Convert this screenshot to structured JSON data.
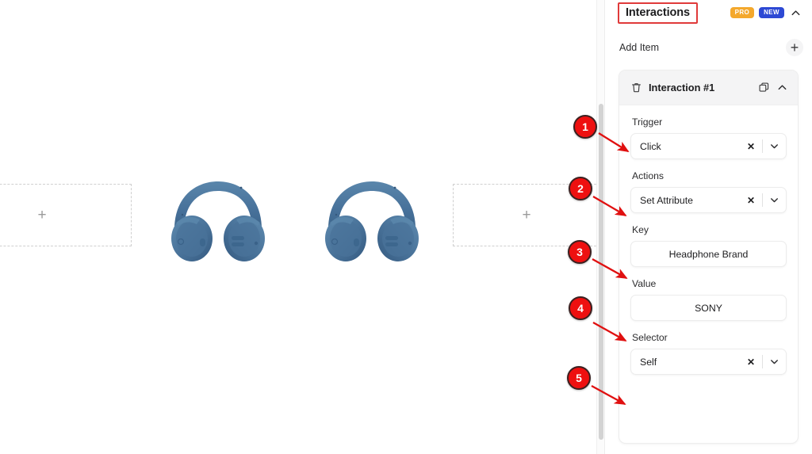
{
  "panel": {
    "title": "Interactions",
    "badges": [
      {
        "label": "PRO",
        "color": "#f4a82c"
      },
      {
        "label": "NEW",
        "color": "#2d49d4"
      }
    ],
    "collapse_icon": "chevron-up-icon",
    "add_item": {
      "label": "Add Item",
      "button_glyph": "+"
    },
    "card": {
      "title": "Interaction #1",
      "delete_icon": "trash-icon",
      "duplicate_icon": "copy-icon",
      "collapse_icon": "chevron-up-icon",
      "fields": [
        {
          "label": "Trigger",
          "type": "select",
          "value": "Click",
          "clear_glyph": "✕",
          "caret_icon": "chevron-down-icon"
        },
        {
          "label": "Actions",
          "type": "select",
          "value": "Set Attribute",
          "clear_glyph": "✕",
          "caret_icon": "chevron-down-icon"
        },
        {
          "label": "Key",
          "type": "text",
          "value": "Headphone Brand"
        },
        {
          "label": "Value",
          "type": "text",
          "value": "SONY"
        },
        {
          "label": "Selector",
          "type": "select",
          "value": "Self",
          "clear_glyph": "✕",
          "caret_icon": "chevron-down-icon"
        }
      ]
    }
  },
  "canvas": {
    "placeholders": [
      {
        "name": "placeholder-left",
        "glyph": "+"
      },
      {
        "name": "placeholder-right",
        "glyph": "+"
      }
    ],
    "products": [
      {
        "name": "headphones-image-1",
        "alt": "Blue over-ear headphones",
        "color": "#4b7497"
      },
      {
        "name": "headphones-image-2",
        "alt": "Blue over-ear headphones",
        "color": "#4b7497"
      }
    ]
  },
  "annotations": {
    "highlight_color": "#e03a3a",
    "badge_color": "#ee1010",
    "callouts": [
      {
        "number": "1",
        "target": "trigger-select"
      },
      {
        "number": "2",
        "target": "actions-select"
      },
      {
        "number": "3",
        "target": "key-input"
      },
      {
        "number": "4",
        "target": "value-input"
      },
      {
        "number": "5",
        "target": "selector-select"
      }
    ]
  }
}
